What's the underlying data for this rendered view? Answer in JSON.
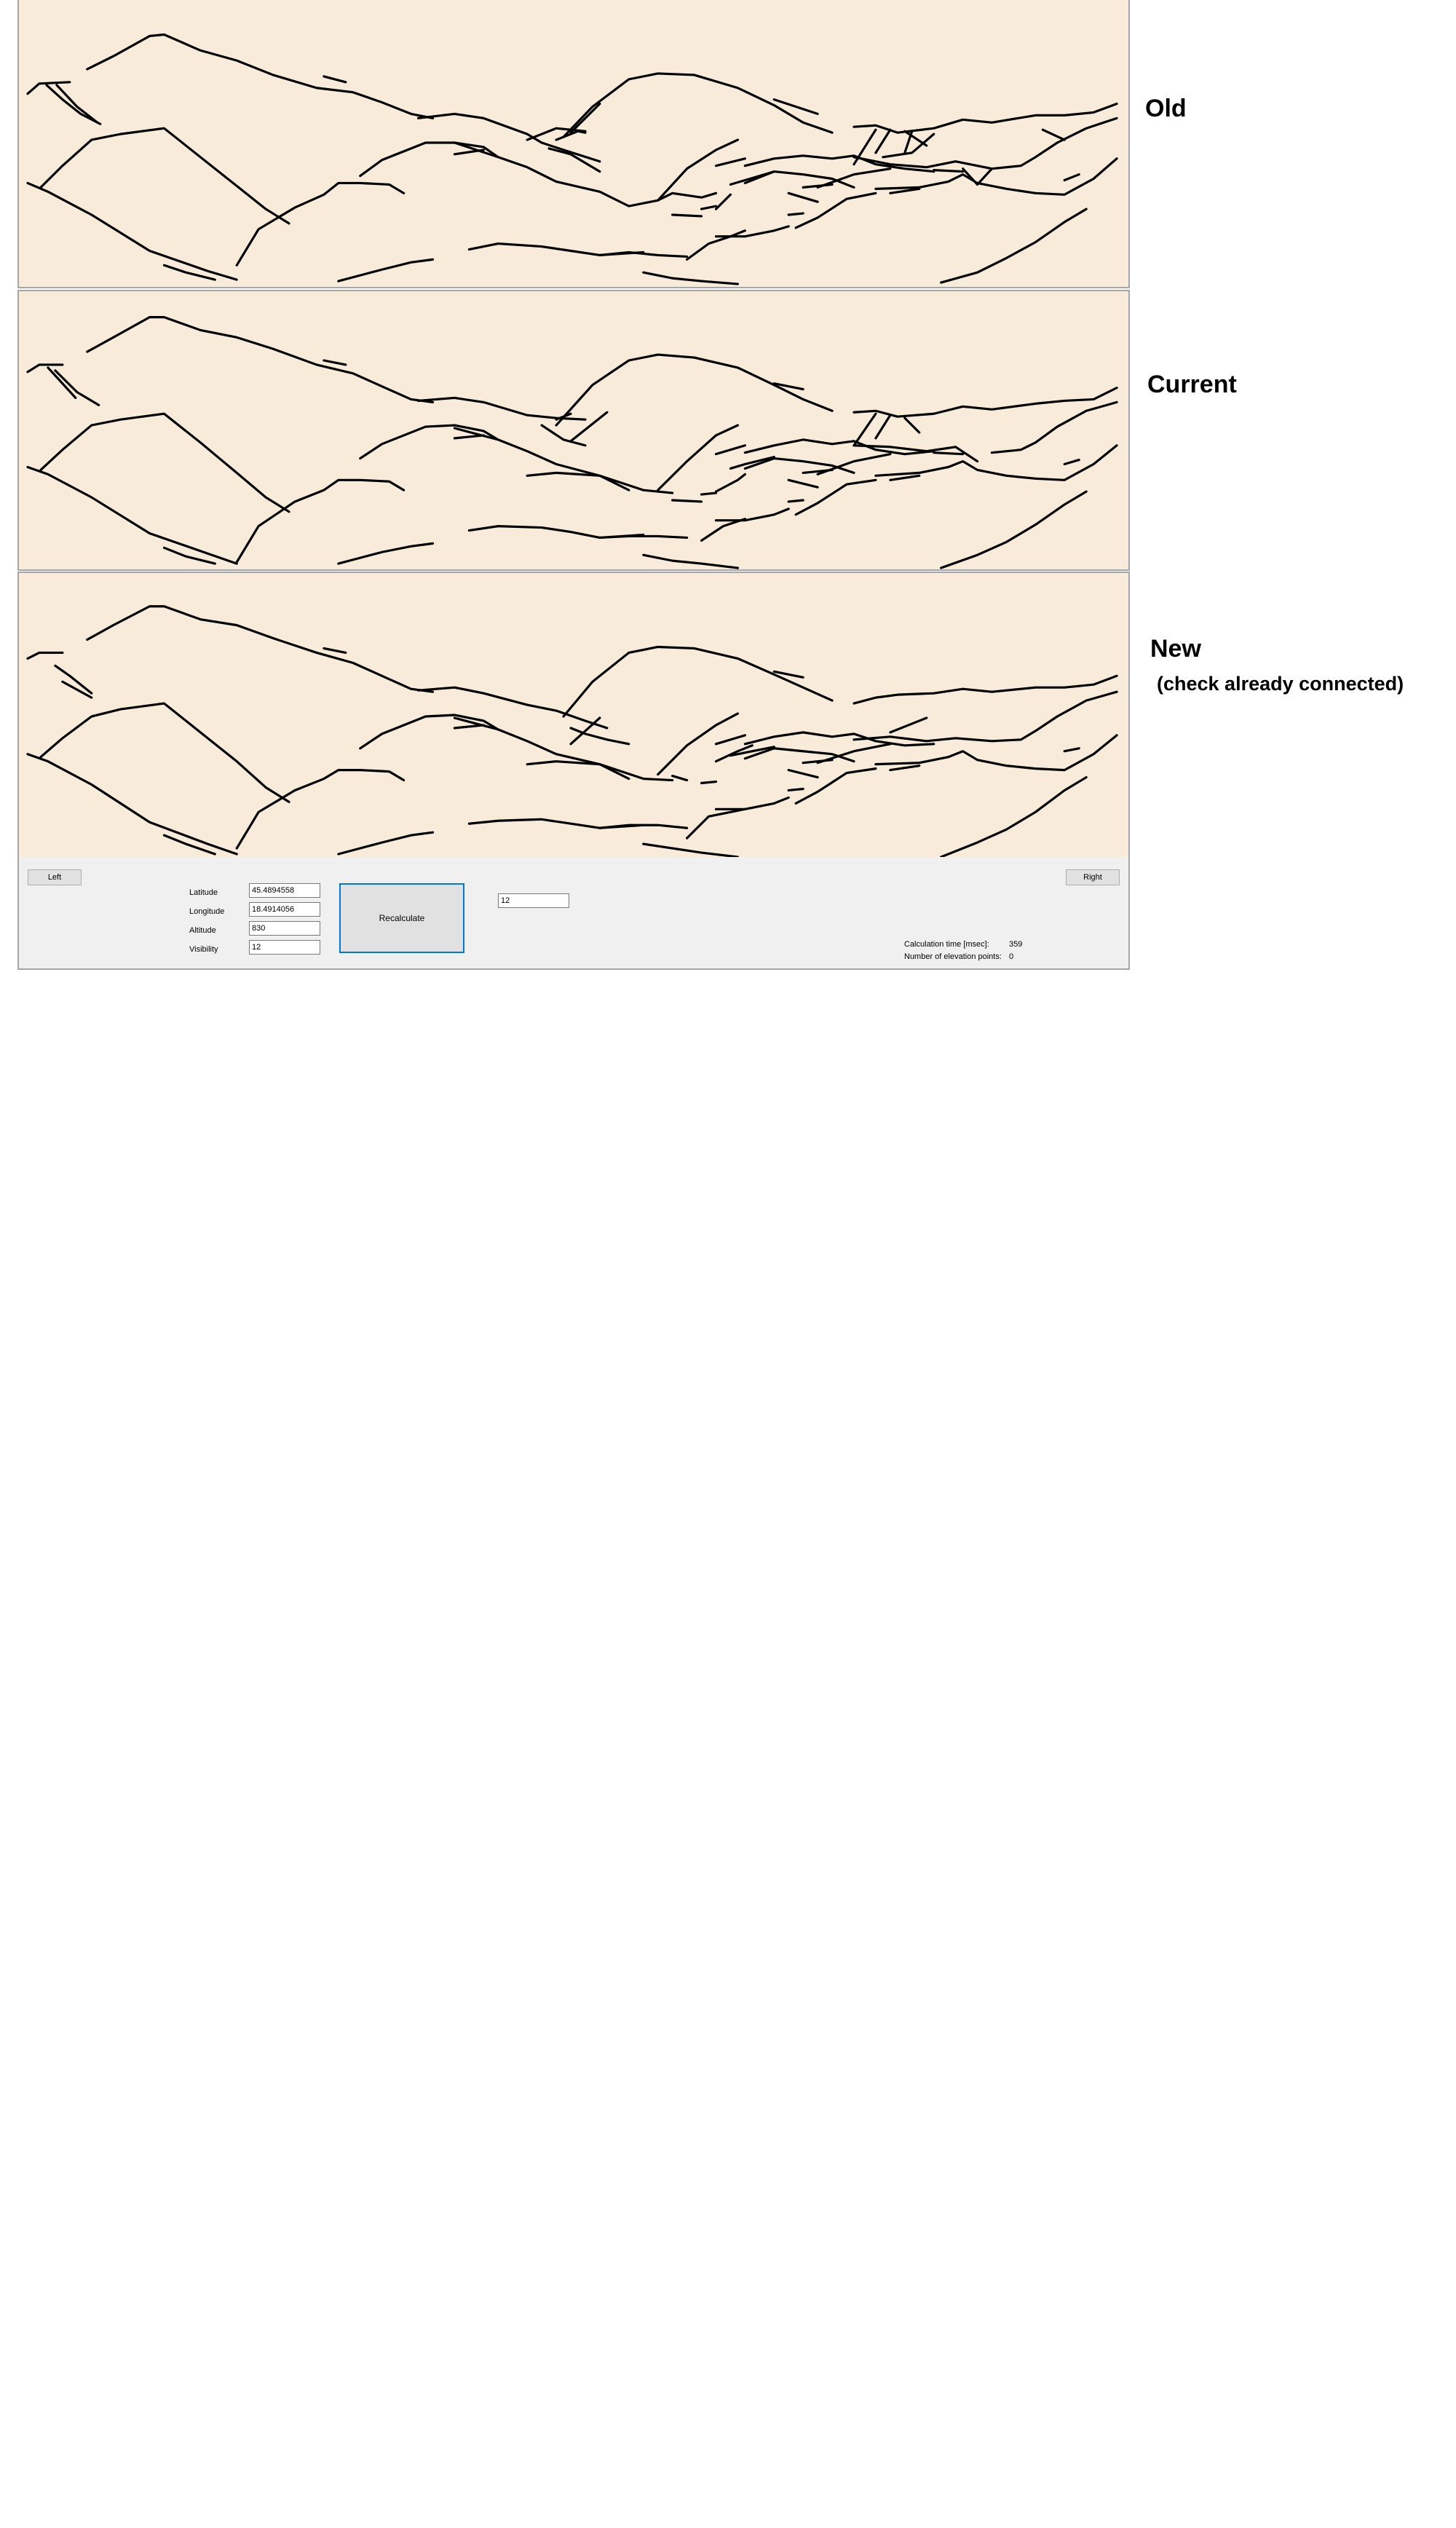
{
  "panels": {
    "old": {
      "label": "Old"
    },
    "current": {
      "label": "Current"
    },
    "new": {
      "label": "New",
      "sublabel": "(check already connected)"
    }
  },
  "controls": {
    "left_button": "Left",
    "right_button": "Right",
    "recalculate_button": "Recalculate",
    "latitude": {
      "label": "Latitude",
      "value": "45.4894558"
    },
    "longitude": {
      "label": "Longitude",
      "value": "18.4914056"
    },
    "altitude": {
      "label": "Altitude",
      "value": "830"
    },
    "visibility": {
      "label": "Visibility",
      "value": "12"
    },
    "extra_field_value": "12",
    "calc_time": {
      "label": "Calculation time [msec]:",
      "value": "359"
    },
    "elevation_points": {
      "label": "Number of elevation points:",
      "value": "0"
    }
  },
  "colors": {
    "panel_background": "#f8ebda",
    "control_background": "#f0f0f0",
    "button_focus_border": "#0078d7"
  }
}
